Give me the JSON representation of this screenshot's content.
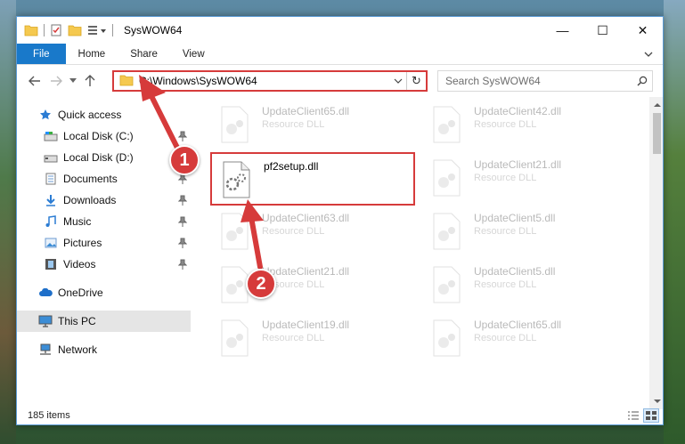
{
  "window": {
    "title": "SysWOW64",
    "controls": {
      "minimize": "—",
      "maximize": "☐",
      "close": "✕"
    }
  },
  "ribbon": {
    "tabs": [
      "File",
      "Home",
      "Share",
      "View"
    ]
  },
  "address": {
    "path": "C:\\Windows\\SysWOW64",
    "refresh_glyph": "↻"
  },
  "search": {
    "placeholder": "Search SysWOW64"
  },
  "nav_pane": {
    "quick_access": "Quick access",
    "items": [
      {
        "label": "Local Disk (C:)",
        "icon": "drive-icon",
        "pinned": true
      },
      {
        "label": "Local Disk (D:)",
        "icon": "drive-icon",
        "pinned": false
      },
      {
        "label": "Documents",
        "icon": "documents-icon",
        "pinned": true
      },
      {
        "label": "Downloads",
        "icon": "downloads-icon",
        "pinned": true
      },
      {
        "label": "Music",
        "icon": "music-icon",
        "pinned": true
      },
      {
        "label": "Pictures",
        "icon": "pictures-icon",
        "pinned": true
      },
      {
        "label": "Videos",
        "icon": "videos-icon",
        "pinned": true
      }
    ],
    "onedrive": "OneDrive",
    "this_pc": "This PC",
    "network": "Network"
  },
  "files": [
    {
      "name": "UpdateClient65.dll",
      "type": "Resource DLL"
    },
    {
      "name": "UpdateClient42.dll",
      "type": "Resource DLL"
    },
    {
      "name": "pf2setup.dll",
      "type": ""
    },
    {
      "name": "UpdateClient21.dll",
      "type": "Resource DLL"
    },
    {
      "name": "UpdateClient63.dll",
      "type": "Resource DLL"
    },
    {
      "name": "UpdateClient5.dll",
      "type": "Resource DLL"
    },
    {
      "name": "UpdateClient21.dll",
      "type": "Resource DLL"
    },
    {
      "name": "UpdateClient5.dll",
      "type": "Resource DLL"
    },
    {
      "name": "UpdateClient19.dll",
      "type": "Resource DLL"
    },
    {
      "name": "UpdateClient65.dll",
      "type": "Resource DLL"
    }
  ],
  "status": {
    "item_count": "185 items"
  },
  "callouts": [
    "1",
    "2"
  ],
  "colors": {
    "accent": "#1979ca",
    "highlight": "#d63b3b",
    "selection": "#cce8ff"
  }
}
